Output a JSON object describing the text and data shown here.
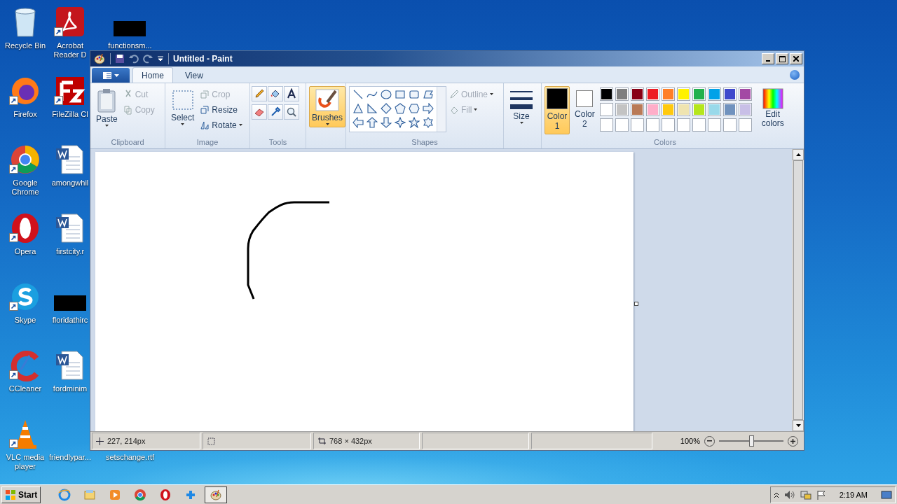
{
  "desktop": {
    "columns": [
      [
        {
          "label": "Recycle Bin",
          "kind": "recycle",
          "shortcut": false
        },
        {
          "label": "Firefox",
          "kind": "firefox",
          "shortcut": true
        },
        {
          "label": "Google Chrome",
          "kind": "chrome",
          "shortcut": true
        },
        {
          "label": "Opera",
          "kind": "opera",
          "shortcut": true
        },
        {
          "label": "Skype",
          "kind": "skype",
          "shortcut": true
        },
        {
          "label": "CCleaner",
          "kind": "ccleaner",
          "shortcut": true
        },
        {
          "label": "VLC media player",
          "kind": "vlc",
          "shortcut": true
        }
      ],
      [
        {
          "label": "Acrobat Reader D",
          "kind": "acrobat",
          "shortcut": true
        },
        {
          "label": "FileZilla Cl",
          "kind": "filezilla",
          "shortcut": true
        },
        {
          "label": "amongwhil",
          "kind": "word",
          "shortcut": false
        },
        {
          "label": "firstcity.r",
          "kind": "word",
          "shortcut": false
        },
        {
          "label": "floridathirc",
          "kind": "redacted"
        },
        {
          "label": "fordminim",
          "kind": "word",
          "shortcut": false
        },
        {
          "label": "friendlypar...",
          "kind": "covered"
        }
      ],
      [
        {
          "label": "functionsm...",
          "kind": "redacted"
        },
        {
          "label": "setschange.rtf",
          "kind": "covered"
        }
      ]
    ]
  },
  "paint": {
    "title": "Untitled - Paint",
    "tabs": [
      {
        "label": "Home",
        "selected": true
      },
      {
        "label": "View",
        "selected": false
      }
    ],
    "clipboard": {
      "caption": "Clipboard",
      "paste": "Paste",
      "actions": [
        {
          "kind": "cut",
          "label": "Cut",
          "disabled": true
        },
        {
          "kind": "copy",
          "label": "Copy",
          "disabled": true
        }
      ]
    },
    "image": {
      "caption": "Image",
      "select": "Select",
      "actions": [
        {
          "kind": "crop",
          "label": "Crop",
          "disabled": true
        },
        {
          "kind": "resize",
          "label": "Resize",
          "disabled": false
        },
        {
          "kind": "rotate",
          "label": "Rotate",
          "disabled": false
        }
      ]
    },
    "tools": {
      "caption": "Tools",
      "items": [
        {
          "kind": "pencil",
          "selected": false
        },
        {
          "kind": "fill",
          "selected": false
        },
        {
          "kind": "text",
          "selected": false
        },
        {
          "kind": "eraser",
          "selected": false
        },
        {
          "kind": "picker",
          "selected": false
        },
        {
          "kind": "magnifier",
          "selected": false
        }
      ]
    },
    "brushes": {
      "label": "Brushes",
      "selected": true
    },
    "shapes": {
      "caption": "Shapes",
      "items": [
        {
          "kind": "line"
        },
        {
          "kind": "curve"
        },
        {
          "kind": "oval"
        },
        {
          "kind": "rectangle"
        },
        {
          "kind": "rounded"
        },
        {
          "kind": "polygon"
        },
        {
          "kind": "triangle"
        },
        {
          "kind": "right-triangle"
        },
        {
          "kind": "diamond"
        },
        {
          "kind": "pentagon"
        },
        {
          "kind": "hexagon"
        },
        {
          "kind": "right-arrow"
        },
        {
          "kind": "left-arrow"
        },
        {
          "kind": "up-arrow"
        },
        {
          "kind": "down-arrow"
        },
        {
          "kind": "star4"
        },
        {
          "kind": "star5"
        },
        {
          "kind": "star6"
        }
      ],
      "outline": {
        "label": "Outline",
        "disabled": true
      },
      "fill": {
        "label": "Fill",
        "disabled": true
      }
    },
    "size": {
      "label": "Size"
    },
    "colors": {
      "caption": "Colors",
      "edit": "Edit colors",
      "slots": [
        {
          "label": "Color 1",
          "color": "#000000",
          "selected": true
        },
        {
          "label": "Color 2",
          "color": "#ffffff",
          "selected": false
        }
      ],
      "palette": [
        {
          "kind": "swatch",
          "color": "#000000"
        },
        {
          "kind": "swatch",
          "color": "#7f7f7f"
        },
        {
          "kind": "swatch",
          "color": "#880015"
        },
        {
          "kind": "swatch",
          "color": "#ed1c24"
        },
        {
          "kind": "swatch",
          "color": "#ff7f27"
        },
        {
          "kind": "swatch",
          "color": "#fff200"
        },
        {
          "kind": "swatch",
          "color": "#22b14c"
        },
        {
          "kind": "swatch",
          "color": "#00a2e8"
        },
        {
          "kind": "swatch",
          "color": "#3f48cc"
        },
        {
          "kind": "swatch",
          "color": "#a349a4"
        },
        {
          "kind": "swatch",
          "color": "#ffffff"
        },
        {
          "kind": "swatch",
          "color": "#c3c3c3"
        },
        {
          "kind": "swatch",
          "color": "#b97a57"
        },
        {
          "kind": "swatch",
          "color": "#ffaec9"
        },
        {
          "kind": "swatch",
          "color": "#ffc90e"
        },
        {
          "kind": "swatch",
          "color": "#efe4b0"
        },
        {
          "kind": "swatch",
          "color": "#b5e61d"
        },
        {
          "kind": "swatch",
          "color": "#99d9ea"
        },
        {
          "kind": "swatch",
          "color": "#7092be"
        },
        {
          "kind": "swatch",
          "color": "#c8bfe7"
        },
        {
          "kind": "empty"
        },
        {
          "kind": "empty"
        },
        {
          "kind": "empty"
        },
        {
          "kind": "empty"
        },
        {
          "kind": "empty"
        },
        {
          "kind": "empty"
        },
        {
          "kind": "empty"
        },
        {
          "kind": "empty"
        },
        {
          "kind": "empty"
        },
        {
          "kind": "empty"
        }
      ]
    },
    "status": {
      "position": "227, 214px",
      "size": "768 × 432px",
      "zoom": "100%",
      "zoom_slider": {
        "level": 0.5
      }
    }
  },
  "taskbar": {
    "start": "Start",
    "apps": [
      {
        "kind": "ie",
        "selected": false
      },
      {
        "kind": "explorer",
        "selected": false
      },
      {
        "kind": "media",
        "selected": false
      },
      {
        "kind": "chrome",
        "selected": false
      },
      {
        "kind": "opera",
        "selected": false
      },
      {
        "kind": "plus",
        "selected": false
      },
      {
        "kind": "paint",
        "selected": true
      }
    ],
    "time": "2:19 AM"
  }
}
